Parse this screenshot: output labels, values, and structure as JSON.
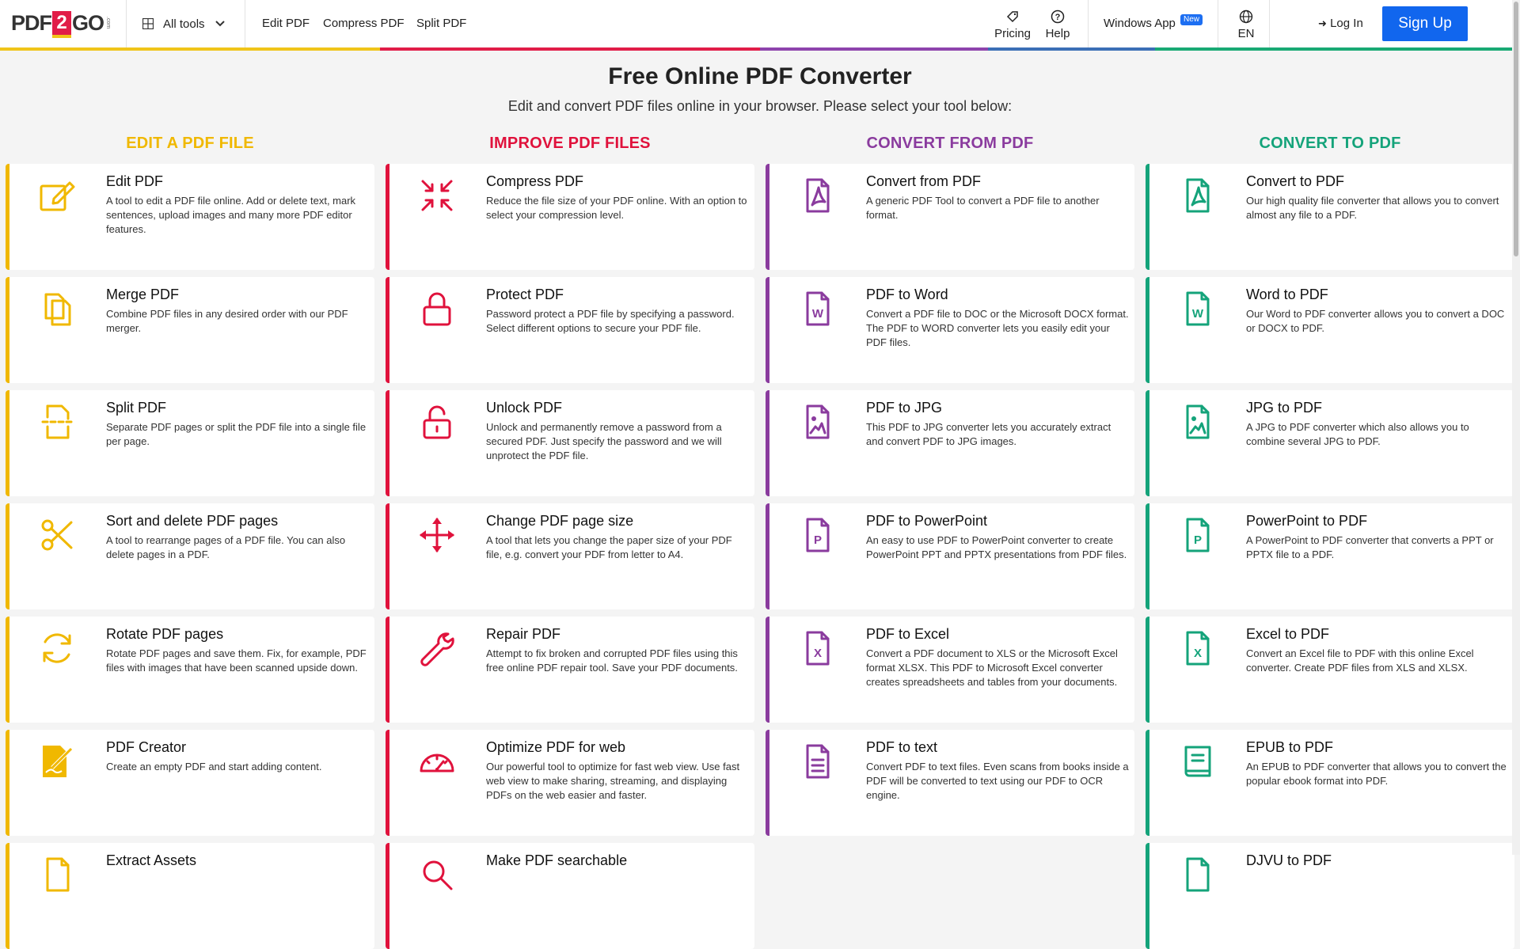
{
  "header": {
    "logo": {
      "pdf": "PDF",
      "two": "2",
      "go": "GO",
      "com": ".com"
    },
    "all_tools": "All tools",
    "nav": [
      "Edit PDF",
      "Compress PDF",
      "Split PDF"
    ],
    "pricing": "Pricing",
    "help": "Help",
    "windows_app": "Windows App",
    "new_badge": "New",
    "language": "EN",
    "login": "Log In",
    "signup": "Sign Up"
  },
  "main": {
    "title": "Free Online PDF Converter",
    "subtitle": "Edit and convert PDF files online in your browser. Please select your tool below:"
  },
  "colors": {
    "edit": "#f0b800",
    "improve": "#e0123c",
    "from": "#8a3b9e",
    "to": "#14a37a"
  },
  "columns": [
    {
      "heading": "EDIT A PDF FILE",
      "cards": [
        {
          "title": "Edit PDF",
          "desc": "A tool to edit a PDF file online. Add or delete text, mark sentences, upload images and many more PDF editor features.",
          "icon": "edit-icon"
        },
        {
          "title": "Merge PDF",
          "desc": "Combine PDF files in any desired order with our PDF merger.",
          "icon": "merge-icon"
        },
        {
          "title": "Split PDF",
          "desc": "Separate PDF pages or split the PDF file into a single file per page.",
          "icon": "split-icon"
        },
        {
          "title": "Sort and delete PDF pages",
          "desc": "A tool to rearrange pages of a PDF file. You can also delete pages in a PDF.",
          "icon": "scissors-icon"
        },
        {
          "title": "Rotate PDF pages",
          "desc": "Rotate PDF pages and save them. Fix, for example, PDF files with images that have been scanned upside down.",
          "icon": "rotate-icon"
        },
        {
          "title": "PDF Creator",
          "desc": "Create an empty PDF and start adding content.",
          "icon": "pdf-creator-icon"
        },
        {
          "title": "Extract Assets",
          "desc": "",
          "icon": "extract-icon"
        }
      ]
    },
    {
      "heading": "IMPROVE PDF FILES",
      "cards": [
        {
          "title": "Compress PDF",
          "desc": "Reduce the file size of your PDF online. With an option to select your compression level.",
          "icon": "compress-icon"
        },
        {
          "title": "Protect PDF",
          "desc": "Password protect a PDF file by specifying a password. Select different options to secure your PDF file.",
          "icon": "lock-icon"
        },
        {
          "title": "Unlock PDF",
          "desc": "Unlock and permanently remove a password from a secured PDF. Just specify the password and we will unprotect the PDF file.",
          "icon": "unlock-icon"
        },
        {
          "title": "Change PDF page size",
          "desc": "A tool that lets you change the paper size of your PDF file, e.g. convert your PDF from letter to A4.",
          "icon": "move-arrows-icon"
        },
        {
          "title": "Repair PDF",
          "desc": "Attempt to fix broken and corrupted PDF files using this free online PDF repair tool. Save your PDF documents.",
          "icon": "wrench-icon"
        },
        {
          "title": "Optimize PDF for web",
          "desc": "Our powerful tool to optimize for fast web view. Use fast web view to make sharing, streaming, and displaying PDFs on the web easier and faster.",
          "icon": "gauge-icon"
        },
        {
          "title": "Make PDF searchable",
          "desc": "",
          "icon": "search-icon"
        }
      ]
    },
    {
      "heading": "CONVERT FROM PDF",
      "cards": [
        {
          "title": "Convert from PDF",
          "desc": "A generic PDF Tool to convert a PDF file to another format.",
          "icon": "pdf-file-icon"
        },
        {
          "title": "PDF to Word",
          "desc": "Convert a PDF file to DOC or the Microsoft DOCX format. The PDF to WORD converter lets you easily edit your PDF files.",
          "icon": "word-file-icon"
        },
        {
          "title": "PDF to JPG",
          "desc": "This PDF to JPG converter lets you accurately extract and convert PDF to JPG images.",
          "icon": "image-file-icon"
        },
        {
          "title": "PDF to PowerPoint",
          "desc": "An easy to use PDF to PowerPoint converter to create PowerPoint PPT and PPTX presentations from PDF files.",
          "icon": "powerpoint-file-icon"
        },
        {
          "title": "PDF to Excel",
          "desc": "Convert a PDF document to XLS or the Microsoft Excel format XLSX. This PDF to Microsoft Excel converter creates spreadsheets and tables from your documents.",
          "icon": "excel-file-icon"
        },
        {
          "title": "PDF to text",
          "desc": "Convert PDF to text files. Even scans from books inside a PDF will be converted to text using our PDF to OCR engine.",
          "icon": "text-file-icon"
        }
      ]
    },
    {
      "heading": "CONVERT TO PDF",
      "cards": [
        {
          "title": "Convert to PDF",
          "desc": "Our high quality file converter that allows you to convert almost any file to a PDF.",
          "icon": "pdf-file-icon"
        },
        {
          "title": "Word to PDF",
          "desc": "Our Word to PDF converter allows you to convert a DOC or DOCX to PDF.",
          "icon": "word-file-icon"
        },
        {
          "title": "JPG to PDF",
          "desc": "A JPG to PDF converter which also allows you to combine several JPG to PDF.",
          "icon": "image-file-icon"
        },
        {
          "title": "PowerPoint to PDF",
          "desc": "A PowerPoint to PDF converter that converts a PPT or PPTX file to a PDF.",
          "icon": "powerpoint-file-icon"
        },
        {
          "title": "Excel to PDF",
          "desc": "Convert an Excel file to PDF with this online Excel converter. Create PDF files from XLS and XLSX.",
          "icon": "excel-file-icon"
        },
        {
          "title": "EPUB to PDF",
          "desc": "An EPUB to PDF converter that allows you to convert the popular ebook format into PDF.",
          "icon": "book-icon"
        },
        {
          "title": "DJVU to PDF",
          "desc": "",
          "icon": "djvu-icon"
        }
      ]
    }
  ]
}
